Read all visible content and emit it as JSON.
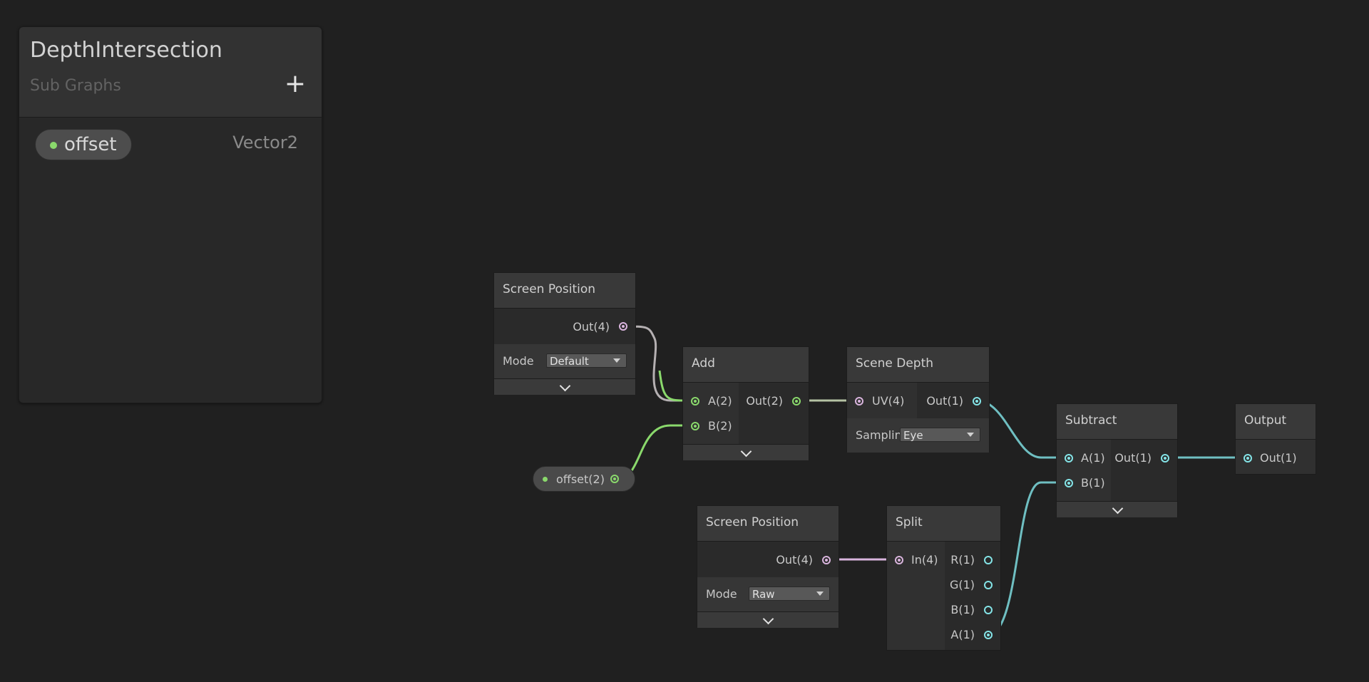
{
  "blackboard": {
    "title": "DepthIntersection",
    "subtitle": "Sub Graphs",
    "add_label": "+",
    "property": {
      "name": "offset",
      "type": "Vector2"
    }
  },
  "nodes": {
    "screen_position_1": {
      "title": "Screen Position",
      "output": "Out(4)",
      "mode_label": "Mode",
      "mode_value": "Default"
    },
    "add": {
      "title": "Add",
      "input_a": "A(2)",
      "input_b": "B(2)",
      "output": "Out(2)"
    },
    "scene_depth": {
      "title": "Scene Depth",
      "input": "UV(4)",
      "output": "Out(1)",
      "sampling_label": "Samplin",
      "sampling_value": "Eye"
    },
    "subtract": {
      "title": "Subtract",
      "input_a": "A(1)",
      "input_b": "B(1)",
      "output": "Out(1)"
    },
    "output": {
      "title": "Output",
      "input": "Out(1)"
    },
    "offset_property": {
      "label": "offset(2)"
    },
    "screen_position_2": {
      "title": "Screen Position",
      "output": "Out(4)",
      "mode_label": "Mode",
      "mode_value": "Raw"
    },
    "split": {
      "title": "Split",
      "input": "In(4)",
      "out_r": "R(1)",
      "out_g": "G(1)",
      "out_b": "B(1)",
      "out_a": "A(1)"
    }
  },
  "colors": {
    "vector4": "#d9b4dd",
    "vector2": "#8ad96c",
    "float": "#84e4e7",
    "background": "#202020"
  }
}
